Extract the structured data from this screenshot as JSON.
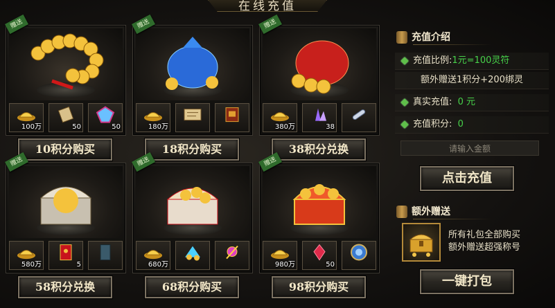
{
  "title": "在线充值",
  "gift_tag": "赠送",
  "packs": [
    {
      "items": [
        {
          "icon": "gold-ingot-icon",
          "count": "100万"
        },
        {
          "icon": "scroll-icon",
          "count": "50"
        },
        {
          "icon": "gem-icon",
          "count": "50"
        }
      ],
      "button": "10积分购买",
      "art": "gold-coins"
    },
    {
      "items": [
        {
          "icon": "gold-ingot-icon",
          "count": "180万"
        },
        {
          "icon": "map-scroll-icon",
          "count": ""
        },
        {
          "icon": "book-icon",
          "count": ""
        }
      ],
      "button": "18积分购买",
      "art": "blue-bag"
    },
    {
      "items": [
        {
          "icon": "gold-ingot-icon",
          "count": "380万"
        },
        {
          "icon": "crystal-icon",
          "count": "38"
        },
        {
          "icon": "rolled-scroll-icon",
          "count": ""
        }
      ],
      "button": "38积分兑换",
      "art": "red-bag"
    },
    {
      "items": [
        {
          "icon": "gold-ingot-icon",
          "count": "580万"
        },
        {
          "icon": "red-envelope-icon",
          "count": "5"
        },
        {
          "icon": "blue-book-icon",
          "count": ""
        }
      ],
      "button": "58积分兑换",
      "art": "silver-chest"
    },
    {
      "items": [
        {
          "icon": "gold-ingot-icon",
          "count": "680万"
        },
        {
          "icon": "diamond-pile-icon",
          "count": ""
        },
        {
          "icon": "pink-charm-icon",
          "count": ""
        }
      ],
      "button": "68积分购买",
      "art": "gold-chest"
    },
    {
      "items": [
        {
          "icon": "gold-ingot-icon",
          "count": "980万"
        },
        {
          "icon": "red-crystal-icon",
          "count": "50"
        },
        {
          "icon": "blue-orb-icon",
          "count": ""
        }
      ],
      "button": "98积分购买",
      "art": "red-chest"
    }
  ],
  "recharge": {
    "header": "充值介绍",
    "ratio_label": "充值比例:",
    "ratio_value": "1元=100灵符",
    "extra": "额外赠送1积分+200绑灵",
    "real_label": "真实充值:",
    "real_value": "0 元",
    "points_label": "充值积分:",
    "points_value": "0",
    "input_placeholder": "请输入金额",
    "button": "点击充值"
  },
  "bonus": {
    "header": "额外赠送",
    "line1": "所有礼包全部购买",
    "line2": "额外赠送超强称号",
    "button": "一键打包"
  }
}
